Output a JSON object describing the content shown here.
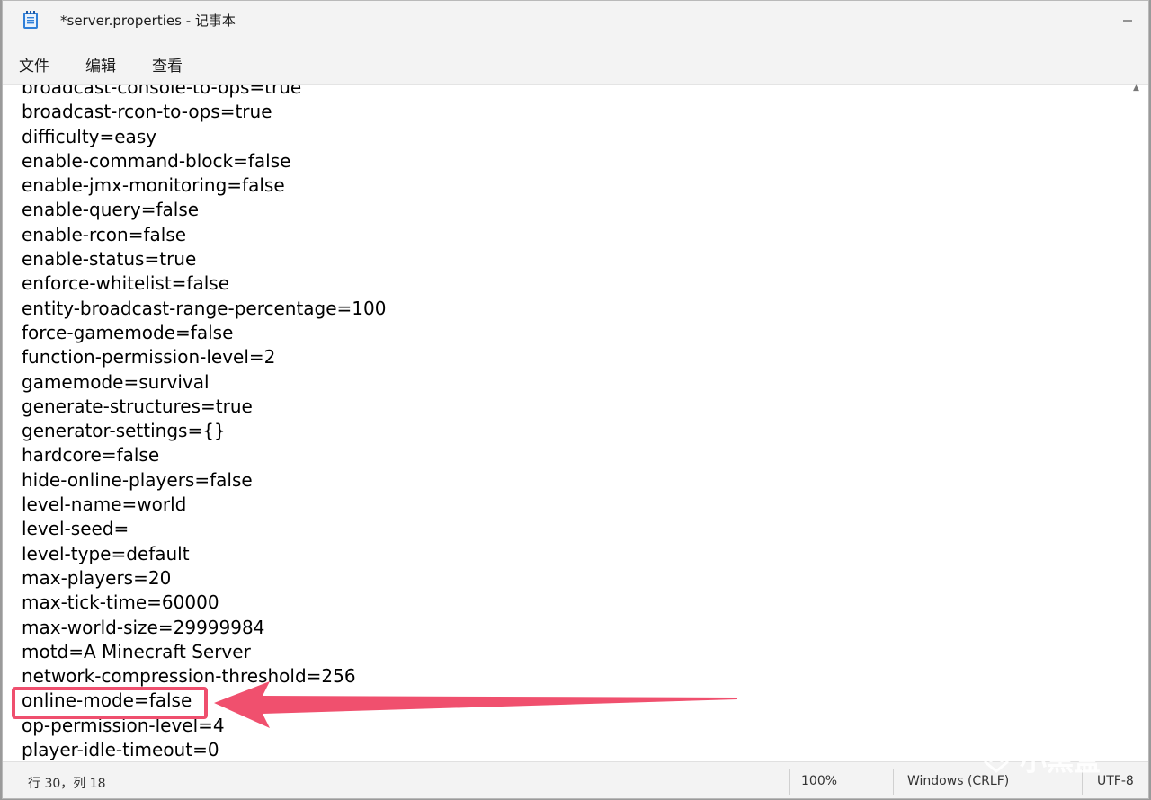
{
  "window": {
    "title": "*server.properties - 记事本"
  },
  "menu": {
    "items": [
      "文件",
      "编辑",
      "查看"
    ]
  },
  "editor": {
    "lines": [
      "broadcast-console-to-ops=true",
      "broadcast-rcon-to-ops=true",
      "difficulty=easy",
      "enable-command-block=false",
      "enable-jmx-monitoring=false",
      "enable-query=false",
      "enable-rcon=false",
      "enable-status=true",
      "enforce-whitelist=false",
      "entity-broadcast-range-percentage=100",
      "force-gamemode=false",
      "function-permission-level=2",
      "gamemode=survival",
      "generate-structures=true",
      "generator-settings={}",
      "hardcore=false",
      "hide-online-players=false",
      "level-name=world",
      "level-seed=",
      "level-type=default",
      "max-players=20",
      "max-tick-time=60000",
      "max-world-size=29999984",
      "motd=A Minecraft Server",
      "network-compression-threshold=256",
      "online-mode=false",
      "op-permission-level=4",
      "player-idle-timeout=0"
    ]
  },
  "status": {
    "position": "行 30，列 18",
    "zoom": "100%",
    "line_ending": "Windows (CRLF)",
    "encoding": "UTF-8"
  },
  "annotation": {
    "highlight_color": "#ef4f6e"
  },
  "watermark": {
    "text": "小黑盒"
  }
}
